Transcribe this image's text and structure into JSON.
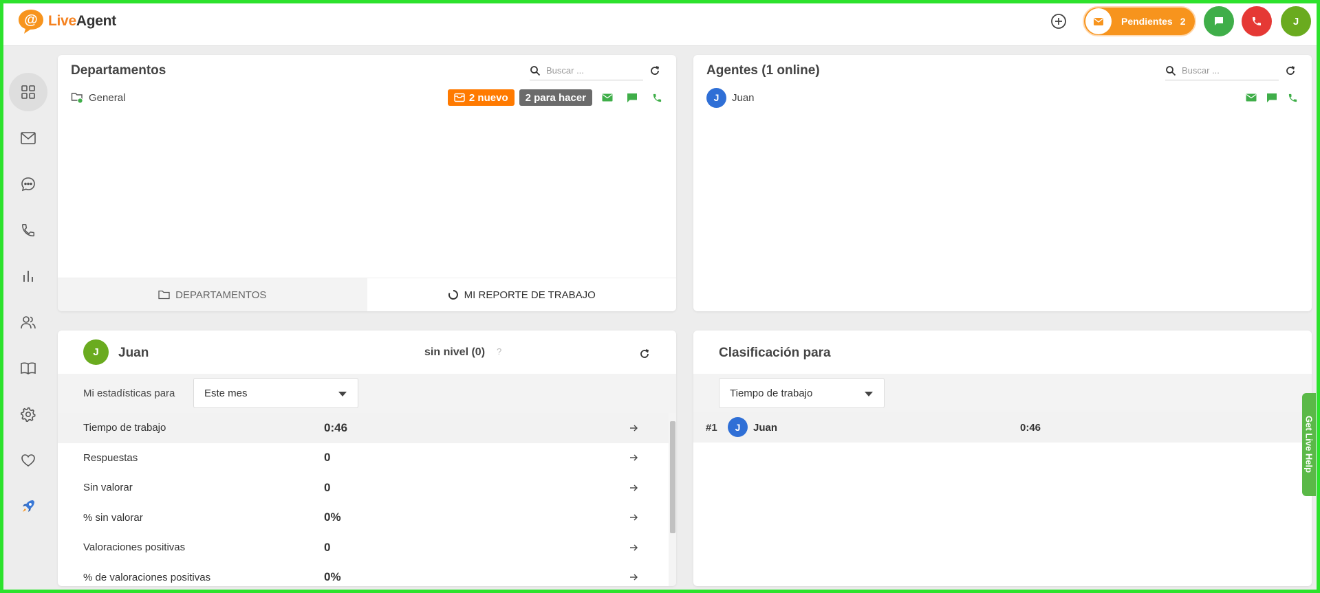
{
  "brand": {
    "name_part1": "Live",
    "name_part2": "Agent",
    "accent": "#f58220"
  },
  "topbar": {
    "pending_label": "Pendientes",
    "pending_count": "2",
    "user_initial": "J",
    "icons": [
      "plus-circle-icon",
      "mail-icon",
      "chat-icon",
      "phone-icon"
    ]
  },
  "sidebar": {
    "items": [
      {
        "icon": "dashboard-icon",
        "active": true
      },
      {
        "icon": "mail-icon"
      },
      {
        "icon": "chat-icon"
      },
      {
        "icon": "phone-icon"
      },
      {
        "icon": "reports-icon"
      },
      {
        "icon": "contacts-icon"
      },
      {
        "icon": "knowledgebase-icon"
      },
      {
        "icon": "settings-icon"
      },
      {
        "icon": "heart-icon"
      },
      {
        "icon": "rocket-icon"
      }
    ]
  },
  "departments": {
    "title": "Departamentos",
    "search_placeholder": "Buscar ...",
    "rows": [
      {
        "name": "General",
        "new_badge": "2 nuevo",
        "todo_badge": "2 para hacer"
      }
    ],
    "tabs": [
      {
        "label": "DEPARTAMENTOS",
        "icon": "folder-icon"
      },
      {
        "label": "MI REPORTE DE TRABAJO",
        "icon": "progress-icon"
      }
    ]
  },
  "agents": {
    "title": "Agentes (1 online)",
    "search_placeholder": "Buscar ...",
    "rows": [
      {
        "initial": "J",
        "name": "Juan"
      }
    ]
  },
  "stats": {
    "user_initial": "J",
    "user_name": "Juan",
    "level": "sin nivel (0)",
    "level_help": "?",
    "filter_label": "Mi estadísticas para",
    "period": "Este mes",
    "rows": [
      {
        "label": "Tiempo de trabajo",
        "value": "0:46"
      },
      {
        "label": "Respuestas",
        "value": "0"
      },
      {
        "label": "Sin valorar",
        "value": "0"
      },
      {
        "label": "% sin valorar",
        "value": "0%"
      },
      {
        "label": "Valoraciones positivas",
        "value": "0"
      },
      {
        "label": "% de valoraciones positivas",
        "value": "0%"
      }
    ]
  },
  "ranking": {
    "title": "Clasificación para",
    "metric": "Tiempo de trabajo",
    "rows": [
      {
        "rank": "#1",
        "initial": "J",
        "name": "Juan",
        "value": "0:46"
      }
    ]
  },
  "live_help": "Get Live Help"
}
